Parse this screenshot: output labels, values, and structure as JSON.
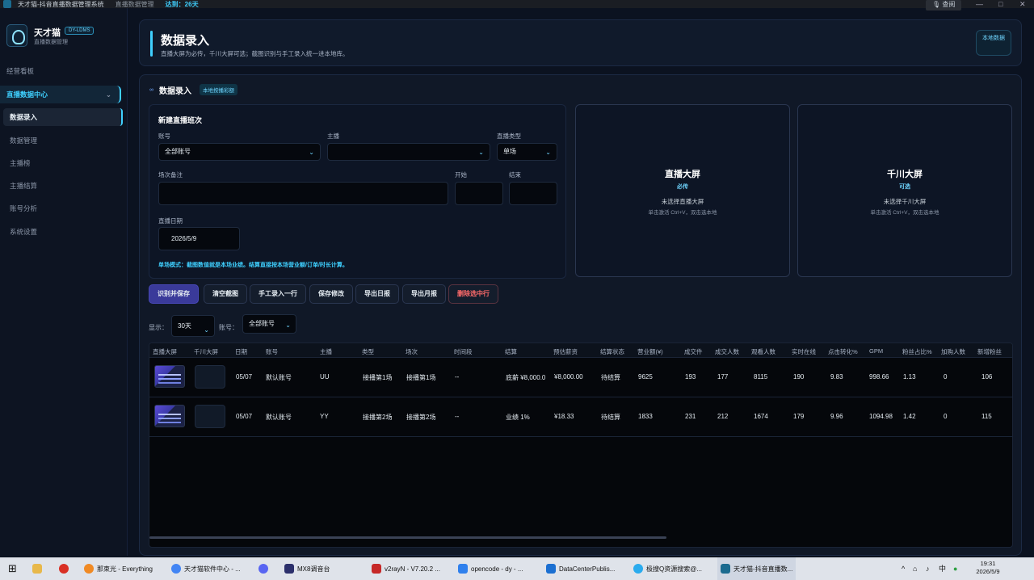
{
  "titlebar": {
    "app_title": "天才猫-抖音直播数据管理系统",
    "section": "直播数据管理",
    "status": "达到：26天",
    "help": "查阅",
    "min": "—",
    "max": "□",
    "close": "✕"
  },
  "sidebar": {
    "app_name": "天才猫",
    "badge": "DY-LDMS",
    "subtitle": "直播数据管理",
    "items": [
      {
        "label": "经营看板"
      },
      {
        "label": "直播数据中心"
      },
      {
        "label": "数据录入"
      },
      {
        "label": "数据管理"
      },
      {
        "label": "主播榜"
      },
      {
        "label": "主播结算"
      },
      {
        "label": "账号分析"
      },
      {
        "label": "系统设置"
      }
    ]
  },
  "header": {
    "title": "数据录入",
    "subtitle": "直播大屏为必传，千川大屏可选；截图识别与手工录入统一进本地库。",
    "button": "本地数据"
  },
  "panel": {
    "title": "数据录入",
    "tag": "本地按播彩额"
  },
  "form": {
    "heading": "新建直播班次",
    "account_label": "账号",
    "account_value": "全部账号",
    "anchor_label": "主播",
    "anchor_value": "",
    "type_label": "直播类型",
    "type_value": "单场",
    "note_label": "场次备注",
    "start_label": "开始",
    "end_label": "结束",
    "date_label": "直播日期",
    "date_value": "2026/5/9",
    "note": "单场模式：截图数值就是本场业绩。结算直接按本场营业额/订单/时长计算。"
  },
  "screens": [
    {
      "title": "直播大屏",
      "req": "必传",
      "status": "未选择直播大屏",
      "hint": "单击激活 Ctrl+V，双击选本地"
    },
    {
      "title": "千川大屏",
      "req": "可选",
      "status": "未选择千川大屏",
      "hint": "单击激活 Ctrl+V，双击选本地"
    }
  ],
  "actions": [
    "识别并保存",
    "清空截图",
    "手工录入一行",
    "保存修改",
    "导出日报",
    "导出月报",
    "删除选中行"
  ],
  "filters": {
    "show_label": "显示：",
    "show_value": "30天",
    "account_label": "账号：",
    "account_value": "全部账号"
  },
  "table": {
    "headers": [
      "直播大屏",
      "千川大屏",
      "日期",
      "账号",
      "主播",
      "类型",
      "场次",
      "时间段",
      "结算",
      "预估薪资",
      "结算状态",
      "营业额(¥)",
      "成交件",
      "成交人数",
      "观看人数",
      "实时在线",
      "点击转化%",
      "GPM",
      "粉丝占比%",
      "加购人数",
      "新增粉丝"
    ],
    "rows": [
      [
        "",
        "",
        "05/07",
        "默认账号",
        "UU",
        "接播第1场",
        "接播第1场",
        "--",
        "底薪 ¥8,000.0",
        "¥8,000.00",
        "待结算",
        "9625",
        "193",
        "177",
        "8115",
        "190",
        "9.83",
        "998.66",
        "1.13",
        "0",
        "106"
      ],
      [
        "",
        "",
        "05/07",
        "默认账号",
        "YY",
        "接播第2场",
        "接播第2场",
        "--",
        "业绩 1%",
        "¥18.33",
        "待结算",
        "1833",
        "231",
        "212",
        "1674",
        "179",
        "9.96",
        "1094.98",
        "1.42",
        "0",
        "115"
      ]
    ]
  },
  "taskbar": {
    "items": [
      "那束光 - Everything",
      "天才猫软件中心 - ...",
      "",
      "MX8调音台",
      "v2rayN - V7.20.2 ...",
      "opencode - dy - ...",
      "DataCenterPublis...",
      "极搜Q资源搜索@...",
      "天才猫-抖音直播数..."
    ],
    "tray": [
      "^",
      "中"
    ],
    "time": "19:31",
    "date": "2026/5/9"
  },
  "colors": {
    "accent": "#3fd0ff",
    "primary_button": "#3a3a9a",
    "danger": "#ff6b6b"
  }
}
